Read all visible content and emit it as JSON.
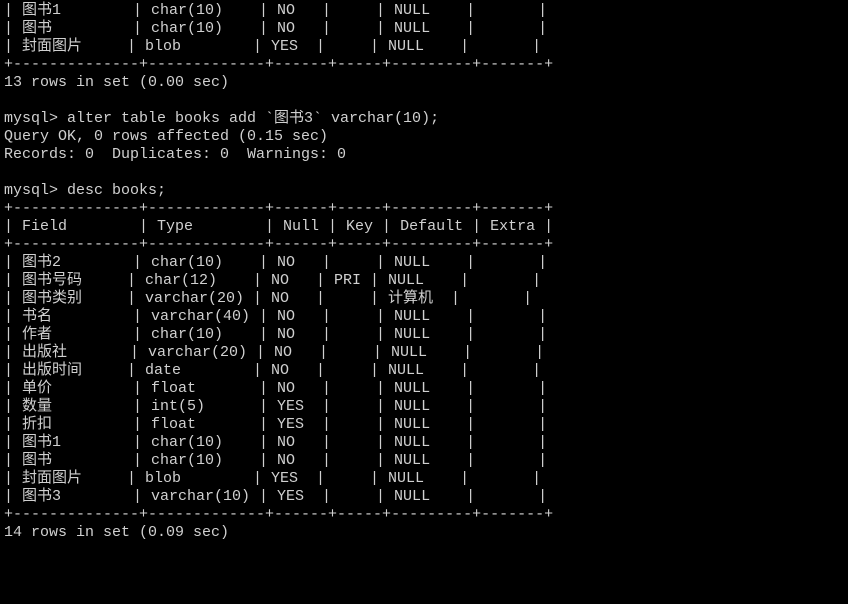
{
  "top_rows": [
    "| 图书1        | char(10)    | NO   |     | NULL    |       |",
    "| 图书         | char(10)    | NO   |     | NULL    |       |",
    "| 封面图片     | blob        | YES  |     | NULL    |       |",
    "+--------------+-------------+------+-----+---------+-------+"
  ],
  "result1": "13 rows in set (0.00 sec)",
  "blank": "",
  "prompt1": "mysql> alter table books add `图书3` varchar(10);",
  "query_ok": "Query OK, 0 rows affected (0.15 sec)",
  "records": "Records: 0  Duplicates: 0  Warnings: 0",
  "prompt2": "mysql> desc books;",
  "header_sep": "+--------------+-------------+------+-----+---------+-------+",
  "header": "| Field        | Type        | Null | Key | Default | Extra |",
  "rows": [
    "| 图书2        | char(10)    | NO   |     | NULL    |       |",
    "| 图书号码     | char(12)    | NO   | PRI | NULL    |       |",
    "| 图书类别     | varchar(20) | NO   |     | 计算机  |       |",
    "| 书名         | varchar(40) | NO   |     | NULL    |       |",
    "| 作者         | char(10)    | NO   |     | NULL    |       |",
    "| 出版社       | varchar(20) | NO   |     | NULL    |       |",
    "| 出版时间     | date        | NO   |     | NULL    |       |",
    "| 单价         | float       | NO   |     | NULL    |       |",
    "| 数量         | int(5)      | YES  |     | NULL    |       |",
    "| 折扣         | float       | YES  |     | NULL    |       |",
    "| 图书1        | char(10)    | NO   |     | NULL    |       |",
    "| 图书         | char(10)    | NO   |     | NULL    |       |",
    "| 封面图片     | blob        | YES  |     | NULL    |       |",
    "| 图书3        | varchar(10) | YES  |     | NULL    |       |"
  ],
  "result2": "14 rows in set (0.09 sec)",
  "chart_data": {
    "type": "table",
    "title": "desc books",
    "columns": [
      "Field",
      "Type",
      "Null",
      "Key",
      "Default",
      "Extra"
    ],
    "rows": [
      [
        "图书2",
        "char(10)",
        "NO",
        "",
        "NULL",
        ""
      ],
      [
        "图书号码",
        "char(12)",
        "NO",
        "PRI",
        "NULL",
        ""
      ],
      [
        "图书类别",
        "varchar(20)",
        "NO",
        "",
        "计算机",
        ""
      ],
      [
        "书名",
        "varchar(40)",
        "NO",
        "",
        "NULL",
        ""
      ],
      [
        "作者",
        "char(10)",
        "NO",
        "",
        "NULL",
        ""
      ],
      [
        "出版社",
        "varchar(20)",
        "NO",
        "",
        "NULL",
        ""
      ],
      [
        "出版时间",
        "date",
        "NO",
        "",
        "NULL",
        ""
      ],
      [
        "单价",
        "float",
        "NO",
        "",
        "NULL",
        ""
      ],
      [
        "数量",
        "int(5)",
        "YES",
        "",
        "NULL",
        ""
      ],
      [
        "折扣",
        "float",
        "YES",
        "",
        "NULL",
        ""
      ],
      [
        "图书1",
        "char(10)",
        "NO",
        "",
        "NULL",
        ""
      ],
      [
        "图书",
        "char(10)",
        "NO",
        "",
        "NULL",
        ""
      ],
      [
        "封面图片",
        "blob",
        "YES",
        "",
        "NULL",
        ""
      ],
      [
        "图书3",
        "varchar(10)",
        "YES",
        "",
        "NULL",
        ""
      ]
    ]
  }
}
